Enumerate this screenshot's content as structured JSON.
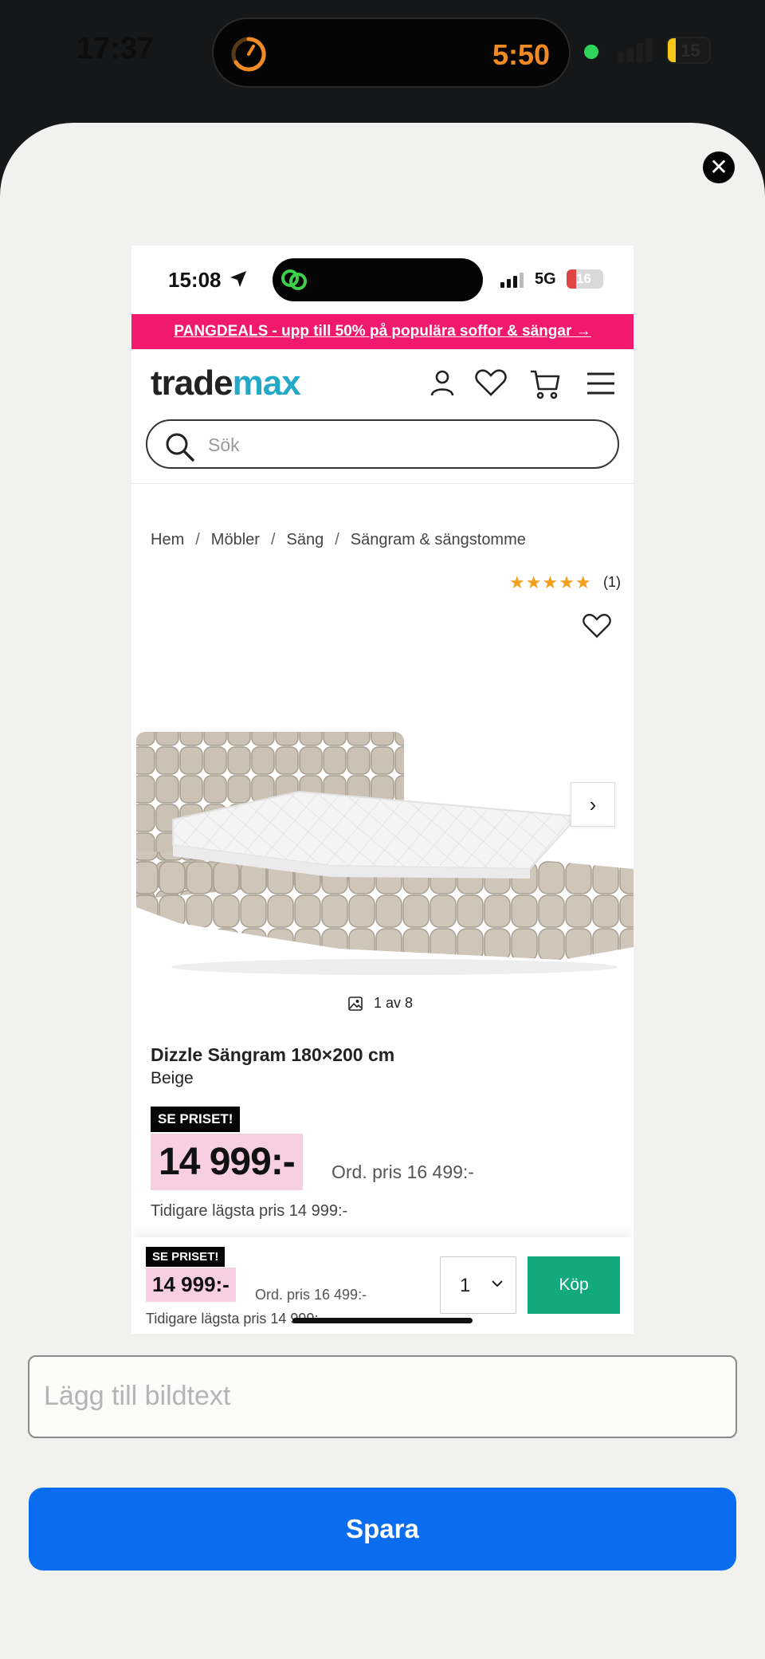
{
  "outer_status": {
    "time": "17:37",
    "timer": "5:50",
    "battery": "15"
  },
  "screenshot": {
    "status": {
      "time": "15:08",
      "network": "5G",
      "battery": "16"
    },
    "promo_banner": "PANGDEALS - upp till 50% på populära soffor & sängar →",
    "logo": {
      "part1": "trade",
      "part2": "max"
    },
    "search_placeholder": "Sök",
    "breadcrumbs": [
      "Hem",
      "Möbler",
      "Säng",
      "Sängram & sängstomme"
    ],
    "rating": {
      "stars": "★★★★★",
      "count": "(1)"
    },
    "image_counter": "1 av 8",
    "product": {
      "title": "Dizzle Sängram 180×200 cm",
      "color": "Beige",
      "badge": "SE PRISET!",
      "price": "14 999:-",
      "ordinary_price": "Ord. pris 16 499:-",
      "lowest_price": "Tidigare lägsta pris 14 999:-"
    },
    "sticky_bar": {
      "badge": "SE PRISET!",
      "price": "14 999:-",
      "ordinary_price": "Ord. pris 16 499:-",
      "lowest_price": "Tidigare lägsta pris 14 999:-",
      "quantity": "1",
      "buy_label": "Köp"
    }
  },
  "caption_placeholder": "Lägg till bildtext",
  "save_label": "Spara",
  "colors": {
    "promo": "#f0196e",
    "price_bg": "#f8cfe1",
    "buy": "#11a97d",
    "save": "#0a6df0",
    "logo_accent": "#23a8c8"
  }
}
